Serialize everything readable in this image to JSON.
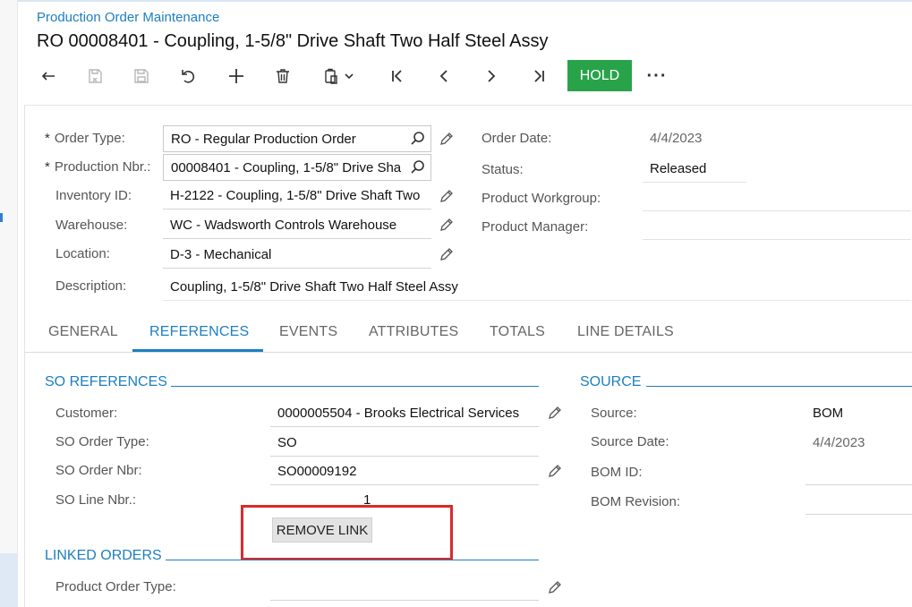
{
  "breadcrumb": "Production Order Maintenance",
  "title": "RO 00008401 - Coupling, 1-5/8\" Drive Shaft Two Half Steel Assy",
  "toolbar": {
    "icons": [
      "undo-back-icon",
      "save-close-icon",
      "save-icon",
      "undo-icon",
      "add-icon",
      "delete-icon",
      "copy-paste-icon",
      "first-record-icon",
      "previous-record-icon",
      "next-record-icon",
      "last-record-icon"
    ],
    "hold_label": "HOLD",
    "more_label": "···"
  },
  "header": {
    "order_type_label": "Order Type:",
    "order_type_value": "RO - Regular Production Order",
    "production_nbr_label": "Production Nbr.:",
    "production_nbr_value": "00008401 - Coupling, 1-5/8\" Drive Sha",
    "inventory_id_label": "Inventory ID:",
    "inventory_id_value": "H-2122 - Coupling, 1-5/8\" Drive Shaft Two",
    "warehouse_label": "Warehouse:",
    "warehouse_value": "WC - Wadsworth Controls Warehouse",
    "location_label": "Location:",
    "location_value": "D-3 - Mechanical",
    "description_label": "Description:",
    "description_value": "Coupling, 1-5/8\" Drive Shaft Two Half Steel Assy",
    "order_date_label": "Order Date:",
    "order_date_value": "4/4/2023",
    "status_label": "Status:",
    "status_value": "Released",
    "product_workgroup_label": "Product Workgroup:",
    "product_workgroup_value": "",
    "product_manager_label": "Product Manager:",
    "product_manager_value": ""
  },
  "tabs": [
    {
      "label": "GENERAL"
    },
    {
      "label": "REFERENCES"
    },
    {
      "label": "EVENTS"
    },
    {
      "label": "ATTRIBUTES"
    },
    {
      "label": "TOTALS"
    },
    {
      "label": "LINE DETAILS"
    }
  ],
  "active_tab": "REFERENCES",
  "so_references": {
    "title": "SO REFERENCES",
    "customer_label": "Customer:",
    "customer_value": "0000005504 - Brooks Electrical Services",
    "so_order_type_label": "SO Order Type:",
    "so_order_type_value": "SO",
    "so_order_nbr_label": "SO Order Nbr:",
    "so_order_nbr_value": "SO00009192",
    "so_line_nbr_label": "SO Line Nbr.:",
    "so_line_nbr_value": "1",
    "remove_link_label": "REMOVE LINK"
  },
  "linked_orders": {
    "title": "LINKED ORDERS",
    "product_order_type_label": "Product Order Type:",
    "product_order_type_value": ""
  },
  "source": {
    "title": "SOURCE",
    "source_label": "Source:",
    "source_value": "BOM",
    "source_date_label": "Source Date:",
    "source_date_value": "4/4/2023",
    "bom_id_label": "BOM ID:",
    "bom_id_value": "",
    "bom_revision_label": "BOM Revision:",
    "bom_revision_value": ""
  },
  "colors": {
    "accent": "#1d7fc1",
    "hold_button": "#29a34a",
    "highlight": "#d92b2b"
  }
}
